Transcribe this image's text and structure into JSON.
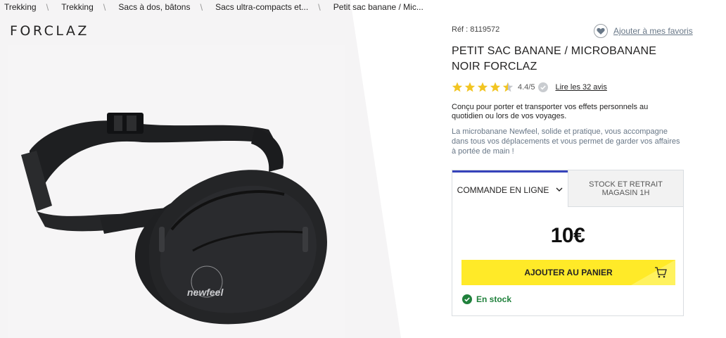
{
  "breadcrumb": [
    "Trekking",
    "Trekking",
    "Sacs à dos, bâtons",
    "Sacs ultra-compacts et...",
    "Petit sac banane / Mic..."
  ],
  "brand": {
    "logo_text": "FORCLAZ"
  },
  "product": {
    "ref": "Réf : 8119572",
    "favorite_label": "Ajouter à mes favoris",
    "title": "PETIT SAC BANANE / MICROBANANE NOIR FORCLAZ",
    "rating_value": "4.4",
    "rating_max": "/5",
    "rating_fraction": 0.88,
    "reviews_link": "Lire les 32 avis",
    "description_short": "Conçu pour porter et transporter vos effets personnels au quotidien ou lors de vos voyages.",
    "description_long": "La microbanane Newfeel, solide et pratique, vous accompagne dans tous vos déplacements et vous permet de garder vos affaires à portée de main !",
    "image_brand_text": "newfeel"
  },
  "buybox": {
    "tab_online": "COMMANDE EN LIGNE",
    "tab_store": "STOCK ET RETRAIT MAGASIN 1H",
    "price": "10€",
    "add_to_cart": "AJOUTER AU PANIER",
    "stock_status": "En stock"
  },
  "colors": {
    "accent_blue": "#3643ba",
    "cart_yellow": "#ffea28",
    "star_yellow": "#f2c522",
    "stock_green": "#20813c"
  }
}
